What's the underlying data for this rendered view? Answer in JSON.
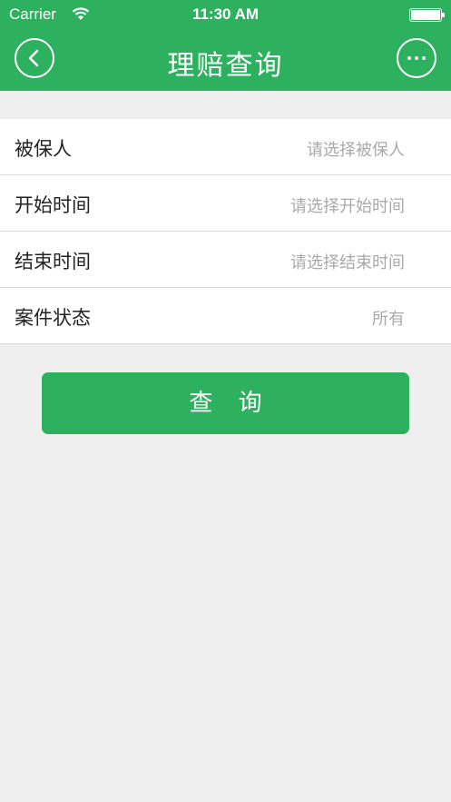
{
  "status_bar": {
    "carrier": "Carrier",
    "time": "11:30 AM",
    "wifi_icon": "wifi-icon",
    "battery_icon": "battery-icon"
  },
  "nav": {
    "title": "理赔查询",
    "back_icon": "chevron-left-icon",
    "more_icon": "more-horizontal-icon"
  },
  "form": {
    "rows": [
      {
        "label": "被保人",
        "value": "请选择被保人"
      },
      {
        "label": "开始时间",
        "value": "请选择开始时间"
      },
      {
        "label": "结束时间",
        "value": "请选择结束时间"
      },
      {
        "label": "案件状态",
        "value": "所有"
      }
    ]
  },
  "actions": {
    "query_label": "查 询"
  },
  "colors": {
    "accent": "#2db15f",
    "background": "#efefef",
    "placeholder": "#a9a9a9"
  }
}
